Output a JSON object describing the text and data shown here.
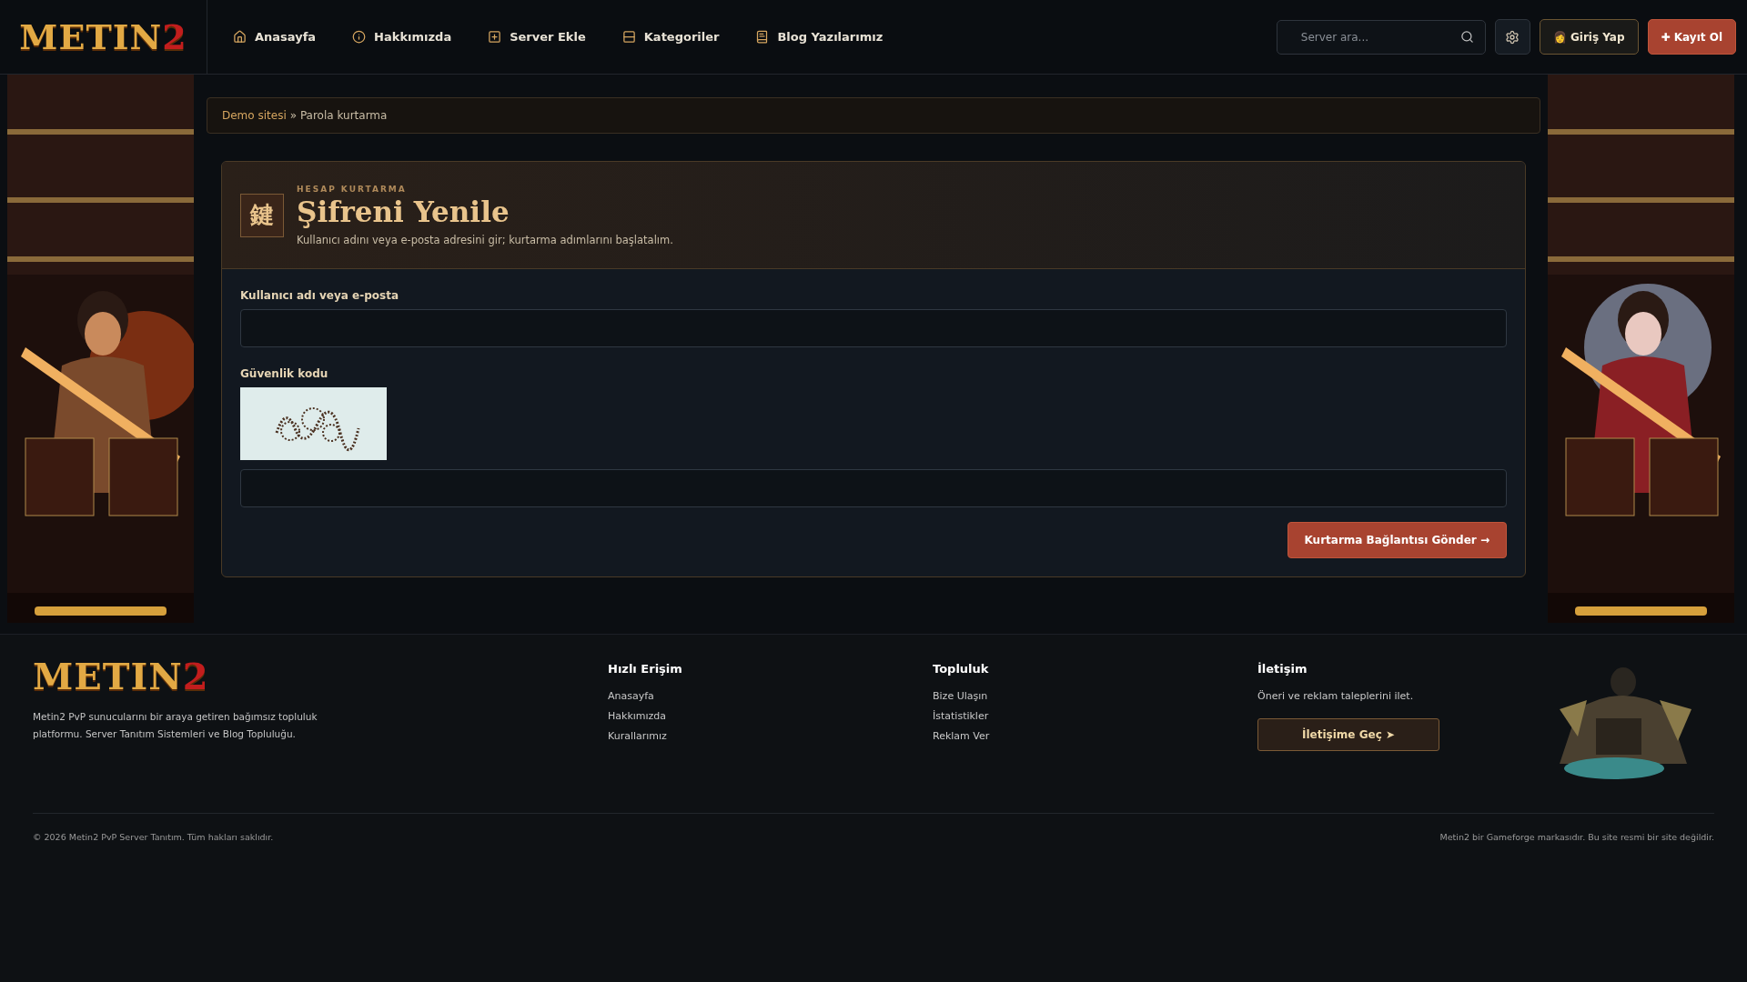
{
  "header": {
    "logo": {
      "text": "METIN",
      "accent": "2"
    },
    "nav": [
      {
        "kind": "home",
        "label": "Anasayfa"
      },
      {
        "kind": "info",
        "label": "Hakkımızda"
      },
      {
        "kind": "add",
        "label": "Server Ekle"
      },
      {
        "kind": "categories",
        "label": "Kategoriler"
      },
      {
        "kind": "blog",
        "label": "Blog Yazılarımız"
      }
    ],
    "search": {
      "placeholder": "Server ara..."
    },
    "login": {
      "icon": "👩",
      "label": "Giriş Yap"
    },
    "register": {
      "icon": "✚",
      "label": "Kayıt Ol"
    }
  },
  "breadcrumb": {
    "link": "Demo sitesi",
    "separator": "»",
    "current": "Parola kurtarma"
  },
  "card": {
    "eyebrow": "HESAP KURTARMA",
    "badge": "鍵",
    "title": "Şifreni Yenile",
    "subtitle": "Kullanıcı adını veya e-posta adresini gir; kurtarma adımlarını başlatalım.",
    "fields": [
      {
        "kind": "text",
        "label": "Kullanıcı adı veya e-posta"
      },
      {
        "kind": "captcha",
        "label": "Güvenlik kodu"
      }
    ],
    "submit": {
      "label": "Kurtarma Bağlantısı Gönder",
      "arrow": "→"
    }
  },
  "footer": {
    "logo": {
      "text": "METIN",
      "accent": "2"
    },
    "description": "Metin2 PvP sunucularını bir araya getiren bağımsız topluluk platformu. Server Tanıtım Sistemleri ve Blog Topluluğu.",
    "columns": [
      {
        "title": "Hızlı Erişim",
        "links": [
          "Anasayfa",
          "Hakkımızda",
          "Kurallarımız"
        ]
      },
      {
        "title": "Topluluk",
        "links": [
          "Bize Ulaşın",
          "İstatistikler",
          "Reklam Ver"
        ]
      }
    ],
    "contact": {
      "title": "İletişim",
      "text": "Öneri ve reklam taleplerini ilet.",
      "button": "İletişime Geç ➤"
    },
    "copyright": "© 2026 Metin2 PvP Server Tanıtım. Tüm hakları saklıdır.",
    "disclaimer": "Metin2 bir Gameforge markasıdır. Bu site resmi bir site değildir."
  }
}
